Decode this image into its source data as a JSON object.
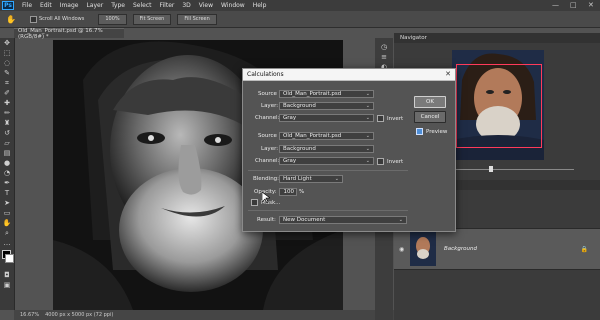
{
  "app": {
    "logo": "Ps"
  },
  "menu": [
    "File",
    "Edit",
    "Image",
    "Layer",
    "Type",
    "Select",
    "Filter",
    "3D",
    "View",
    "Window",
    "Help"
  ],
  "window_controls": {
    "minimize": "—",
    "maximize": "□",
    "close": "✕"
  },
  "options_bar": {
    "scroll_all_windows": "Scroll All Windows",
    "zoom_100": "100%",
    "fit_screen": "Fit Screen",
    "fill_screen": "Fill Screen"
  },
  "document": {
    "tab": "Old_Man_Portrait.psd @ 16.7% (RGB/8#) *",
    "zoom_status": "16.67%",
    "doc_size": "4000 px x 5000 px (72 ppi)"
  },
  "panels": {
    "navigator_title": "Navigator",
    "layer_name": "Background"
  },
  "dialog": {
    "title": "Calculations",
    "source1_label": "Source 1:",
    "source1_value": "Old_Man_Portrait.psd",
    "layer1_label": "Layer:",
    "layer1_value": "Background",
    "channel1_label": "Channel:",
    "channel1_value": "Gray",
    "invert1_label": "Invert",
    "source2_label": "Source 2:",
    "source2_value": "Old_Man_Portrait.psd",
    "layer2_label": "Layer:",
    "layer2_value": "Background",
    "channel2_label": "Channel:",
    "channel2_value": "Gray",
    "invert2_label": "Invert",
    "blending_label": "Blending:",
    "blending_value": "Hard Light",
    "opacity_label": "Opacity:",
    "opacity_value": "100",
    "opacity_unit": "%",
    "mask_label": "Mask...",
    "result_label": "Result:",
    "result_value": "New Document",
    "ok_label": "OK",
    "cancel_label": "Cancel",
    "preview_label": "Preview",
    "preview_checked": true
  },
  "colors": {
    "accent": "#31a8ff",
    "navigator_box": "#ff3a5a"
  }
}
